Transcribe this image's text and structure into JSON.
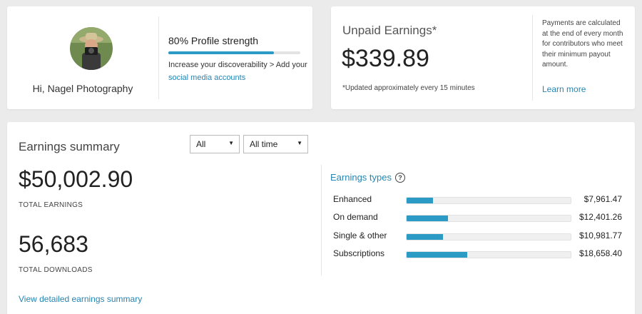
{
  "profile": {
    "greeting": "Hi, Nagel Photography",
    "strength_label": "80% Profile strength",
    "strength_fraction": 0.8,
    "tip_prefix": "Increase your discoverability > Add your ",
    "tip_link": "social media accounts"
  },
  "unpaid": {
    "title": "Unpaid Earnings*",
    "amount": "$339.89",
    "note": "*Updated approximately every 15 minutes",
    "payment_info": "Payments are calculated at the end of every month for contributors who meet their minimum payout amount.",
    "learn_more": "Learn more"
  },
  "summary": {
    "title": "Earnings summary",
    "filter_type": "All",
    "filter_time": "All time",
    "total_earnings": "$50,002.90",
    "total_earnings_label": "TOTAL EARNINGS",
    "total_downloads": "56,683",
    "total_downloads_label": "TOTAL DOWNLOADS",
    "detail_link": "View detailed earnings summary"
  },
  "earnings_types": {
    "title": "Earnings types",
    "help_icon_glyph": "?",
    "items": [
      {
        "label": "Enhanced",
        "value": "$7,961.47",
        "fraction": 0.16
      },
      {
        "label": "On demand",
        "value": "$12,401.26",
        "fraction": 0.25
      },
      {
        "label": "Single & other",
        "value": "$10,981.77",
        "fraction": 0.22
      },
      {
        "label": "Subscriptions",
        "value": "$18,658.40",
        "fraction": 0.37
      }
    ]
  },
  "colors": {
    "accent": "#2b9bc6",
    "link": "#2585b3",
    "background": "#ebebeb"
  }
}
